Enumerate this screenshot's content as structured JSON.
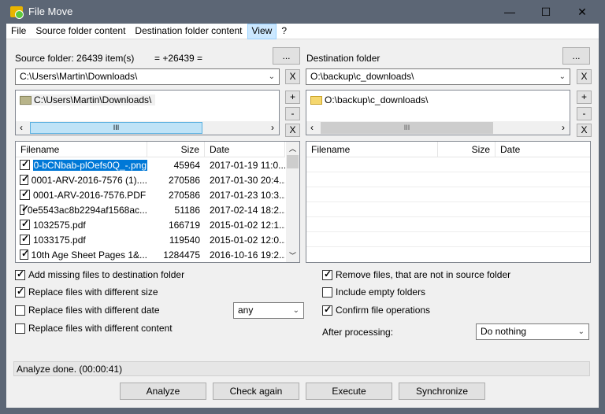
{
  "window": {
    "title": "File Move",
    "minimize": "—",
    "maximize": "☐",
    "close": "✕"
  },
  "menu": [
    "File",
    "Source folder content",
    "Destination folder content",
    "View",
    "?"
  ],
  "source": {
    "label": "Source folder: 26439 item(s)",
    "diff": "= +26439 =",
    "browse": "...",
    "path": "C:\\Users\\Martin\\Downloads\\",
    "clear": "X",
    "tree_item": "C:\\Users\\Martin\\Downloads\\",
    "add": "+",
    "remove": "-",
    "clear_list": "X",
    "columns": [
      "Filename",
      "Size",
      "Date"
    ],
    "files": [
      {
        "name": "0-bCNbab-plOefs0Q_-.png",
        "size": "45964",
        "date": "2017-01-19 11:0...",
        "checked": true
      },
      {
        "name": "0001-ARV-2016-7576 (1)....",
        "size": "270586",
        "date": "2017-01-30 20:4...",
        "checked": true
      },
      {
        "name": "0001-ARV-2016-7576.PDF",
        "size": "270586",
        "date": "2017-01-23 10:3...",
        "checked": true
      },
      {
        "name": "0e5543ac8b2294af1568ac...",
        "size": "51186",
        "date": "2017-02-14 18:2...",
        "checked": true
      },
      {
        "name": "1032575.pdf",
        "size": "166719",
        "date": "2015-01-02 12:1...",
        "checked": true
      },
      {
        "name": "1033175.pdf",
        "size": "119540",
        "date": "2015-01-02 12:0...",
        "checked": true
      },
      {
        "name": "10th Age Sheet Pages 1&...",
        "size": "1284475",
        "date": "2016-10-16 19:2...",
        "checked": true
      }
    ]
  },
  "destination": {
    "label": "Destination folder",
    "browse": "...",
    "path": "O:\\backup\\c_downloads\\",
    "clear": "X",
    "tree_item": "O:\\backup\\c_downloads\\",
    "add": "+",
    "remove": "-",
    "clear_list": "X",
    "columns": [
      "Filename",
      "Size",
      "Date"
    ]
  },
  "options_left": [
    {
      "label": "Add missing files to destination folder",
      "checked": true
    },
    {
      "label": "Replace files with different size",
      "checked": true
    },
    {
      "label": "Replace files with different date",
      "checked": false
    },
    {
      "label": "Replace files with different content",
      "checked": false
    }
  ],
  "date_mode": "any",
  "options_right": [
    {
      "label": "Remove files, that are not in source folder",
      "checked": true
    },
    {
      "label": "Include empty folders",
      "checked": false
    },
    {
      "label": "Confirm file operations",
      "checked": true
    }
  ],
  "after_processing": {
    "label": "After processing:",
    "value": "Do nothing"
  },
  "status": "Analyze done. (00:00:41)",
  "buttons": {
    "analyze": "Analyze",
    "check_again": "Check again",
    "execute": "Execute",
    "synchronize": "Synchronize"
  }
}
